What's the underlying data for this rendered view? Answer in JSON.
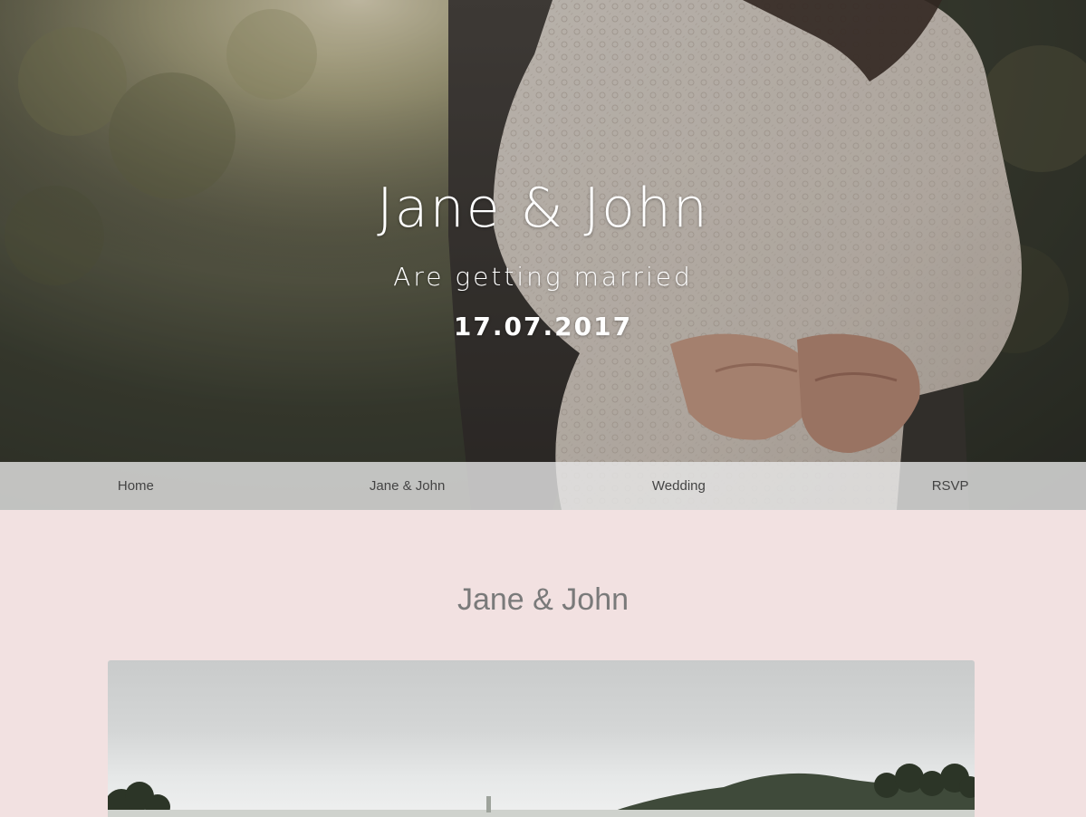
{
  "hero": {
    "title": "Jane & John",
    "subtitle": "Are getting married",
    "date": "17.07.2017"
  },
  "nav": {
    "items": [
      {
        "label": "Home"
      },
      {
        "label": "Jane & John"
      },
      {
        "label": "Wedding"
      },
      {
        "label": "RSVP"
      }
    ]
  },
  "section": {
    "title": "Jane & John"
  },
  "colors": {
    "page_background": "#f2e1e1",
    "nav_background": "#e7e7e7",
    "nav_text": "#444444",
    "section_title": "#7a7a7a",
    "hero_text": "#ffffff"
  }
}
